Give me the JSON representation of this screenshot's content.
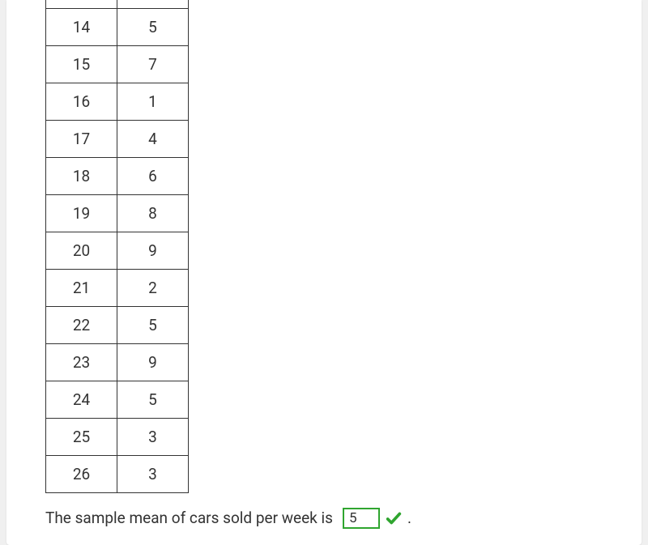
{
  "chart_data": {
    "type": "table",
    "rows": [
      {
        "col1": "14",
        "col2": "5"
      },
      {
        "col1": "15",
        "col2": "7"
      },
      {
        "col1": "16",
        "col2": "1"
      },
      {
        "col1": "17",
        "col2": "4"
      },
      {
        "col1": "18",
        "col2": "6"
      },
      {
        "col1": "19",
        "col2": "8"
      },
      {
        "col1": "20",
        "col2": "9"
      },
      {
        "col1": "21",
        "col2": "2"
      },
      {
        "col1": "22",
        "col2": "5"
      },
      {
        "col1": "23",
        "col2": "9"
      },
      {
        "col1": "24",
        "col2": "5"
      },
      {
        "col1": "25",
        "col2": "3"
      },
      {
        "col1": "26",
        "col2": "3"
      }
    ]
  },
  "sentence": {
    "text": "The sample mean of cars sold per week is",
    "answer": "5",
    "period": "."
  }
}
